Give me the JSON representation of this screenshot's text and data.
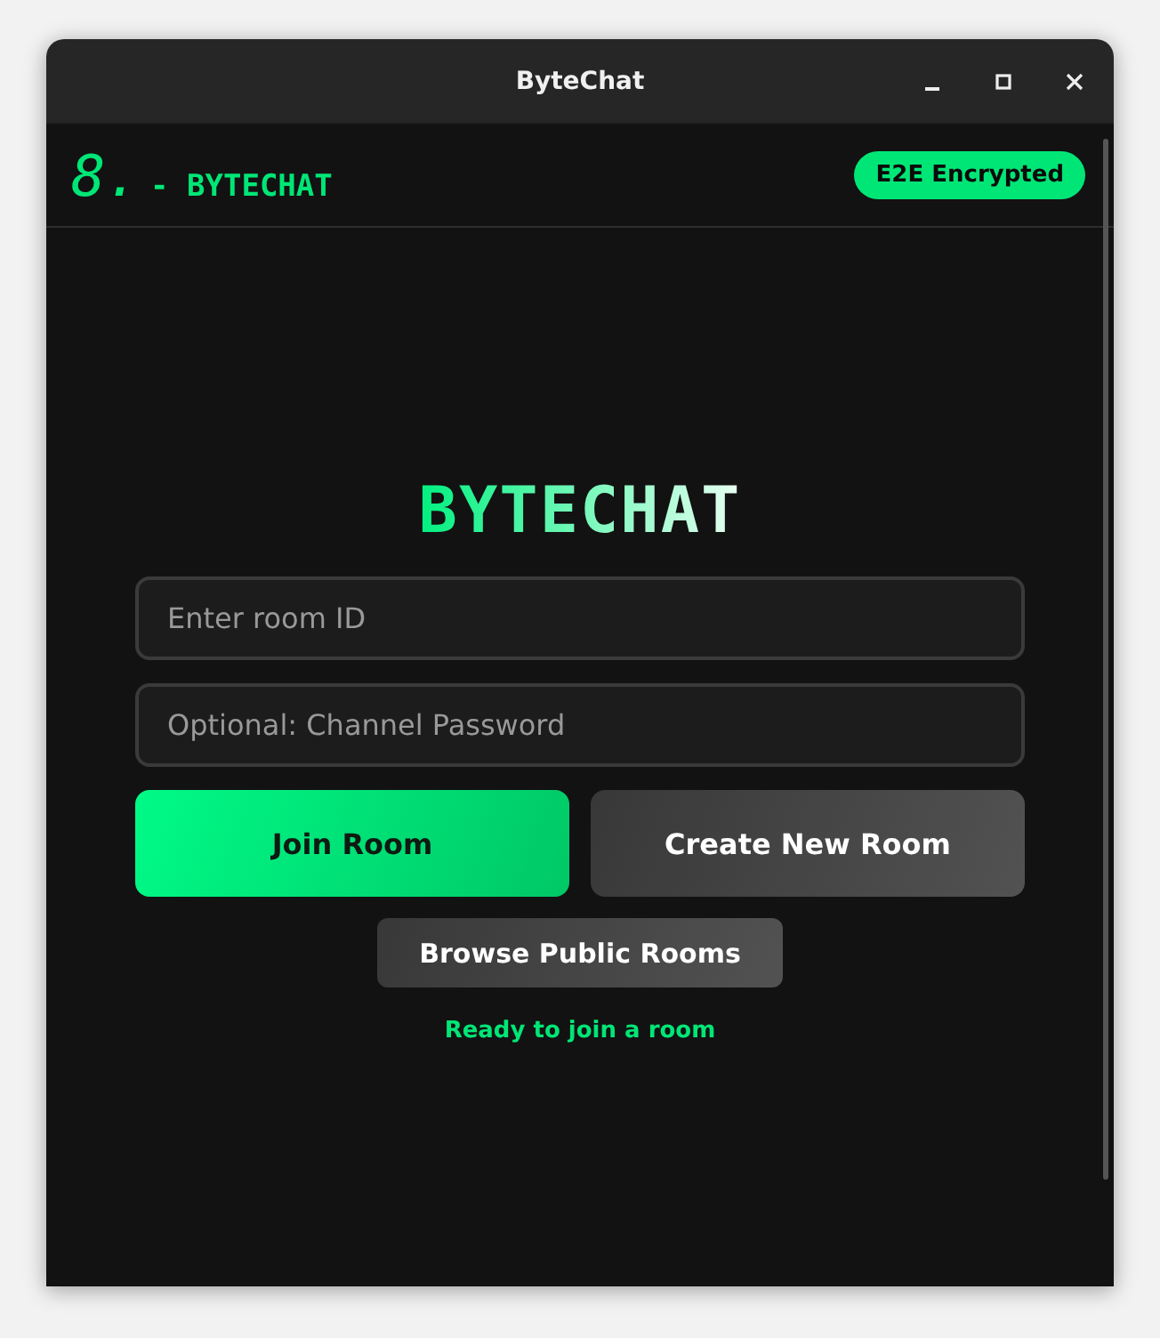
{
  "window": {
    "title": "ByteChat"
  },
  "header": {
    "logo_mark": "8.",
    "logo_text": "- BYTECHAT",
    "badge": "E2E Encrypted"
  },
  "main": {
    "title": "BYTECHAT",
    "fields": [
      {
        "placeholder": "Enter room ID"
      },
      {
        "placeholder": "Optional: Channel Password"
      }
    ],
    "buttons": [
      {
        "label": "Join Room",
        "kind": "primary"
      },
      {
        "label": "Create New Room",
        "kind": "secondary"
      }
    ],
    "browse_button": "Browse Public Rooms",
    "status": "Ready to join a room"
  }
}
